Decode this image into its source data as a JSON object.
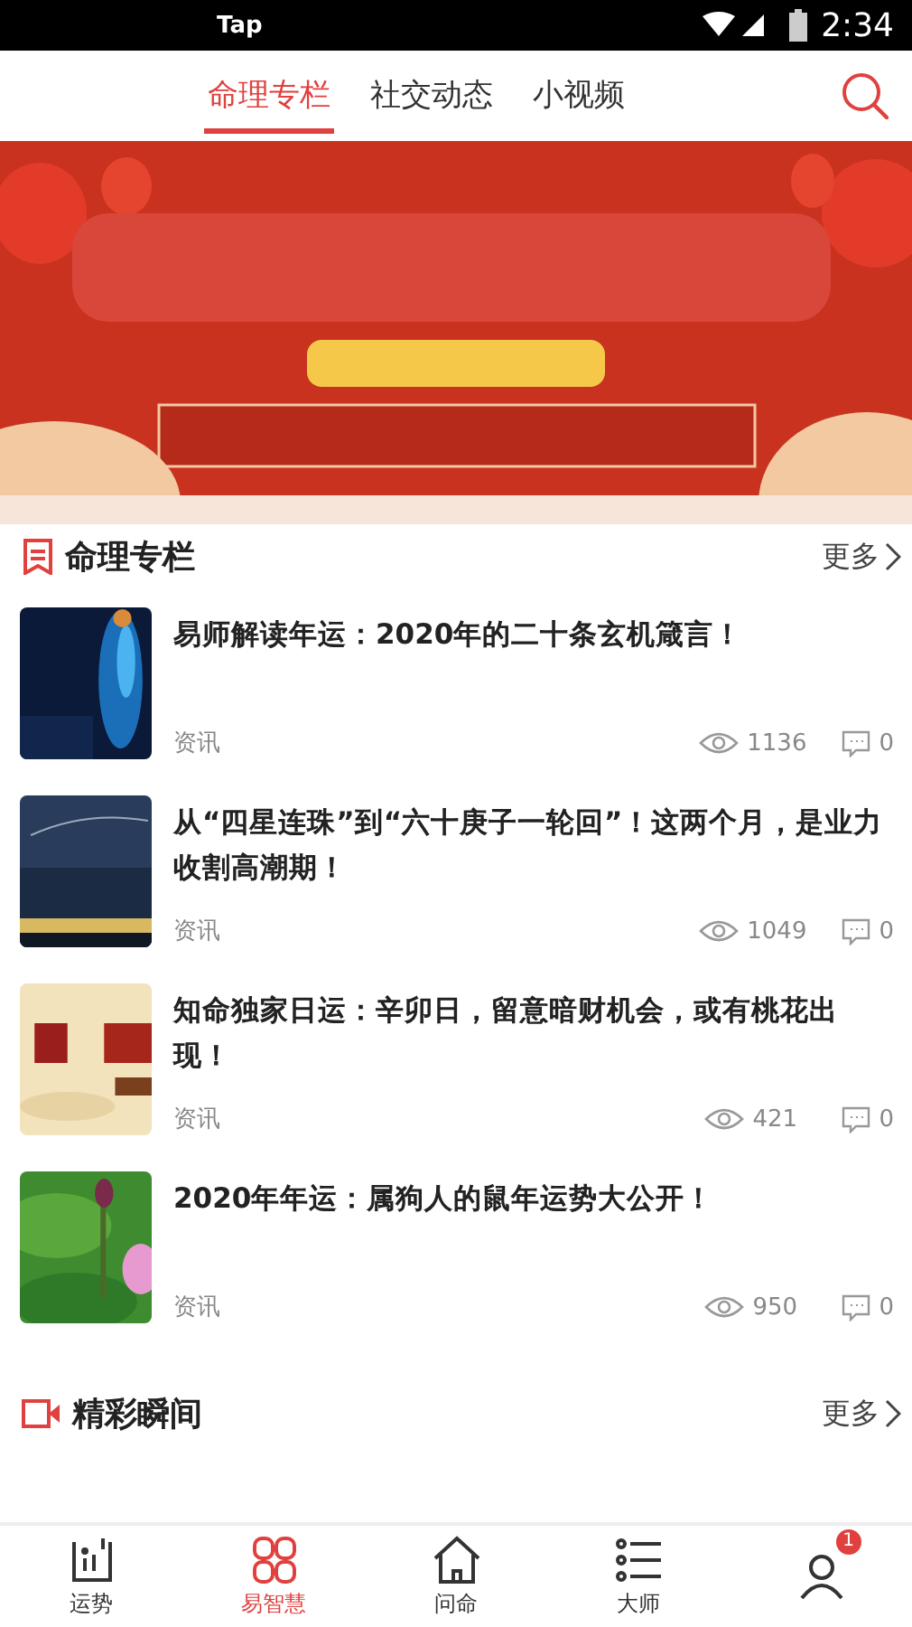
{
  "status_bar": {
    "app_text": "Tap",
    "time": "2:34"
  },
  "top_tabs": [
    {
      "label": "命理专栏",
      "selected": true
    },
    {
      "label": "社交动态",
      "selected": false
    },
    {
      "label": "小视频",
      "selected": false
    }
  ],
  "section": {
    "title": "命理专栏",
    "more": "更多"
  },
  "articles": [
    {
      "title": "易师解读年运：2020年的二十条玄机箴言！",
      "tag": "资讯",
      "views": "1136",
      "comments": "0",
      "kind": "tech"
    },
    {
      "title": "从“四星连珠”到“六十庚子一轮回”！这两个月，是业力收割高潮期！",
      "tag": "资讯",
      "views": "1049",
      "comments": "0",
      "kind": "night"
    },
    {
      "title": "知命独家日运：辛卯日，留意暗财机会，或有桃花出现！",
      "tag": "资讯",
      "views": "421",
      "comments": "0",
      "kind": "paper"
    },
    {
      "title": "2020年年运：属狗人的鼠年运势大公开！",
      "tag": "资讯",
      "views": "950",
      "comments": "0",
      "kind": "lotus"
    }
  ],
  "section2": {
    "title": "精彩瞬间",
    "more": "更多"
  },
  "bottom_nav": [
    {
      "kind": "chart",
      "label": "运势",
      "selected": false
    },
    {
      "kind": "grid",
      "label": "易智慧",
      "selected": true
    },
    {
      "kind": "home",
      "label": "问命",
      "selected": false
    },
    {
      "kind": "list",
      "label": "大师",
      "selected": false
    },
    {
      "kind": "person",
      "badge": "1",
      "selected": false
    }
  ]
}
